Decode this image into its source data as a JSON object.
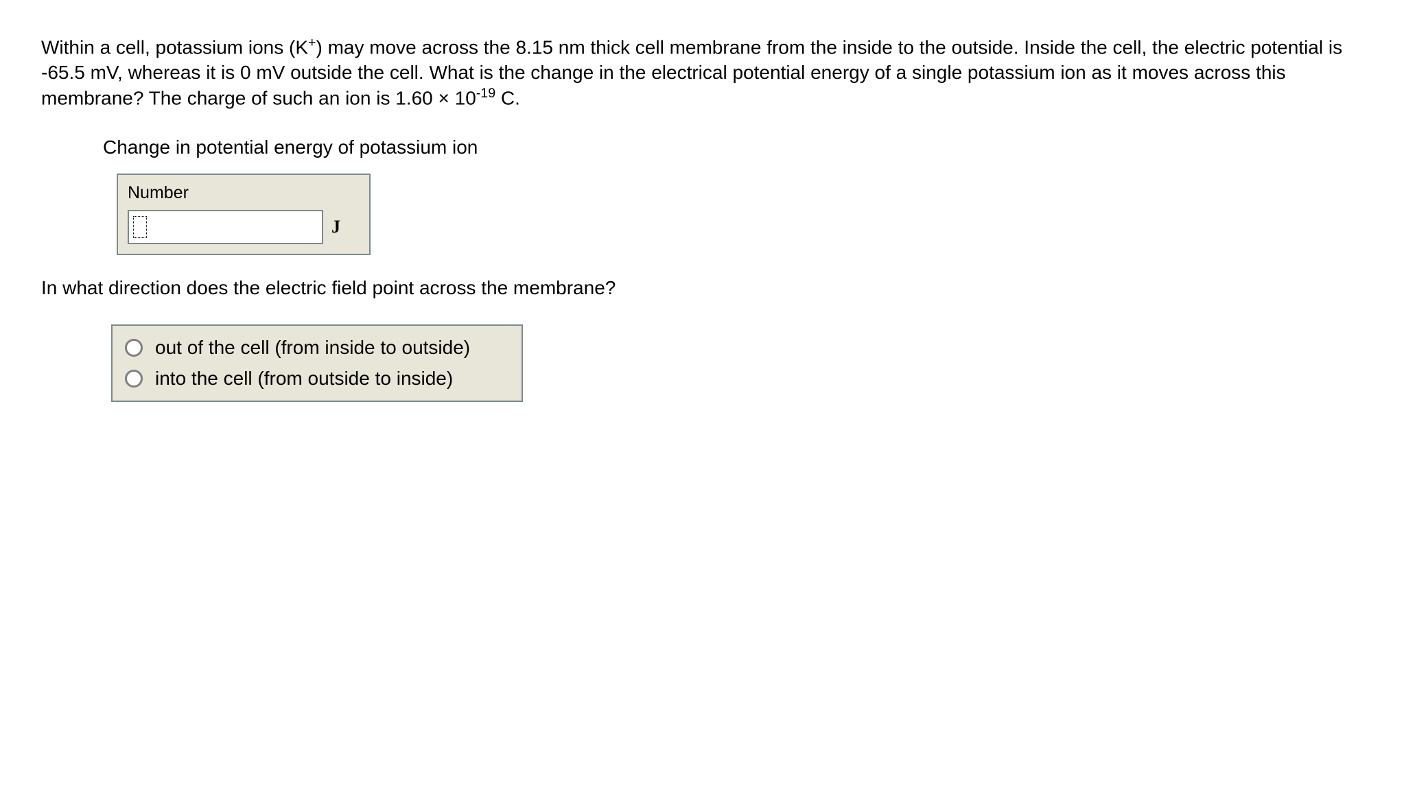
{
  "question": {
    "text_part1": "Within a cell, potassium ions (K",
    "text_sup1": "+",
    "text_part2": ") may move across the 8.15 nm thick cell membrane from the inside to the outside. Inside the cell, the electric potential is -65.5 mV, whereas it is 0 mV outside the cell. What is the change in the electrical potential energy of a single potassium ion as it moves across this membrane? The charge of such an ion is 1.60 × 10",
    "text_sup2": "-19",
    "text_part3": " C."
  },
  "input_section": {
    "label": "Change in potential energy of potassium ion",
    "box_label": "Number",
    "unit": "J",
    "value": ""
  },
  "question2": {
    "text": "In what direction does the electric field point across the membrane?"
  },
  "radio_options": {
    "option1": "out of the cell (from inside to outside)",
    "option2": "into the cell (from outside to inside)"
  }
}
